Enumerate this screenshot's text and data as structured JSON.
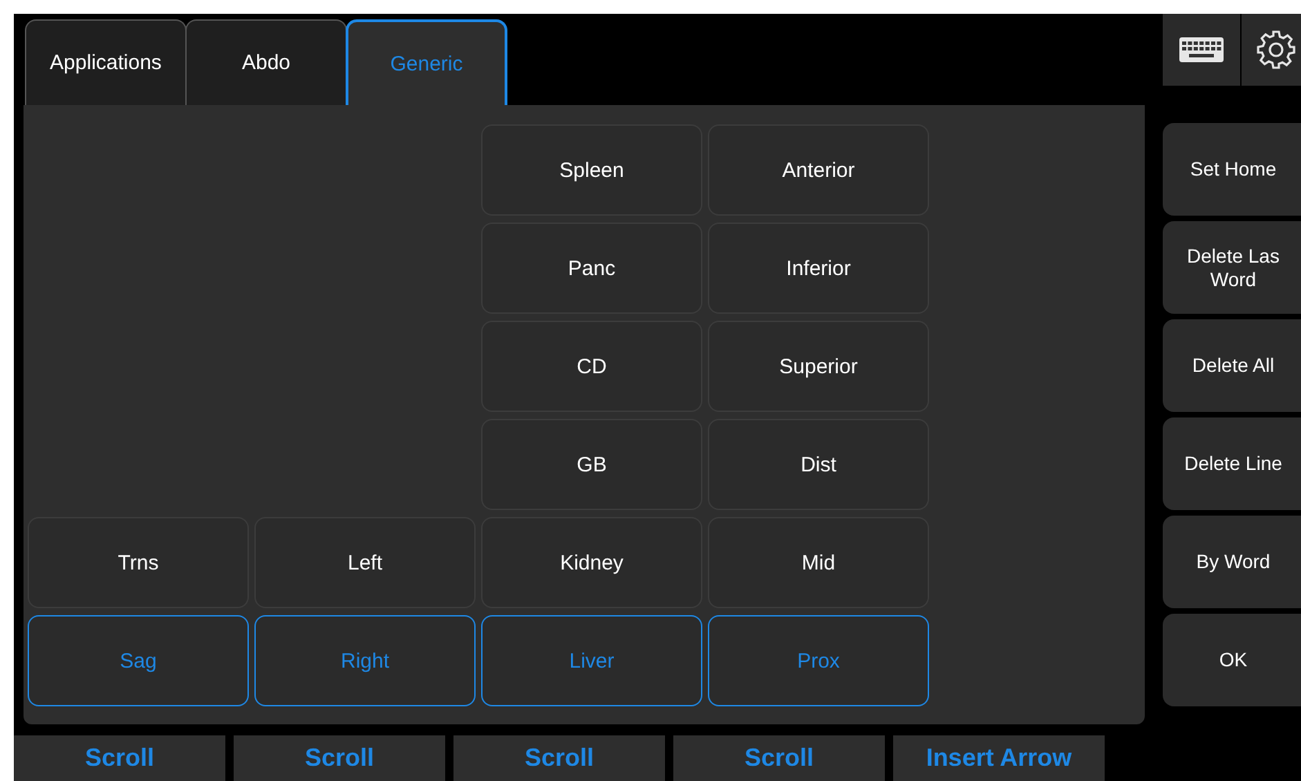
{
  "tabs": [
    {
      "label": "Applications",
      "selected": false
    },
    {
      "label": "Abdo",
      "selected": false
    },
    {
      "label": "Generic",
      "selected": true
    }
  ],
  "annotation_columns": [
    {
      "buttons": [
        {
          "label": "Trns",
          "selected": false
        },
        {
          "label": "Sag",
          "selected": true
        }
      ]
    },
    {
      "buttons": [
        {
          "label": "Left",
          "selected": false
        },
        {
          "label": "Right",
          "selected": true
        }
      ]
    },
    {
      "buttons": [
        {
          "label": "Spleen",
          "selected": false
        },
        {
          "label": "Panc",
          "selected": false
        },
        {
          "label": "CD",
          "selected": false
        },
        {
          "label": "GB",
          "selected": false
        },
        {
          "label": "Kidney",
          "selected": false
        },
        {
          "label": "Liver",
          "selected": true
        }
      ]
    },
    {
      "buttons": [
        {
          "label": "Anterior",
          "selected": false
        },
        {
          "label": "Inferior",
          "selected": false
        },
        {
          "label": "Superior",
          "selected": false
        },
        {
          "label": "Dist",
          "selected": false
        },
        {
          "label": "Mid",
          "selected": false
        },
        {
          "label": "Prox",
          "selected": true
        }
      ]
    }
  ],
  "side_buttons": [
    {
      "lines": [
        "Set Home"
      ]
    },
    {
      "lines": [
        "Delete Las",
        "Word"
      ]
    },
    {
      "lines": [
        "Delete All"
      ]
    },
    {
      "lines": [
        "Delete Line"
      ]
    },
    {
      "lines": [
        "By Word"
      ]
    },
    {
      "lines": [
        "OK"
      ]
    }
  ],
  "bottom_buttons": [
    "Scroll",
    "Scroll",
    "Scroll",
    "Scroll",
    "Insert Arrow"
  ]
}
